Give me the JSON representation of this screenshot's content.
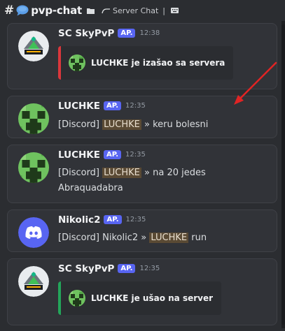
{
  "header": {
    "channel_name": "pvp-chat",
    "topic": "Server Chat",
    "separator": "|"
  },
  "messages": [
    {
      "author": "SC SkyPvP",
      "badge": "AP.",
      "time": "12:38",
      "embed_text": "LUCHKE je izašao sa servera",
      "embed_color": "#da373c"
    },
    {
      "author": "LUCHKE",
      "badge": "AP.",
      "time": "12:35",
      "prefix": "[Discord]",
      "mention": "LUCHKE",
      "arrow": "»",
      "text": "keru bolesni"
    },
    {
      "author": "LUCHKE",
      "badge": "AP.",
      "time": "12:35",
      "prefix": "[Discord]",
      "mention": "LUCHKE",
      "arrow": "»",
      "text": "na 20 jedes",
      "text2": "Abraquadabra"
    },
    {
      "author": "Nikolic2",
      "badge": "AP.",
      "time": "12:35",
      "prefix": "[Discord] Nikolic2",
      "arrow": "»",
      "mention": "LUCHKE",
      "text": "run"
    },
    {
      "author": "SC SkyPvP",
      "badge": "AP.",
      "time": "12:35",
      "embed_text": "LUCHKE je ušao na server",
      "embed_color": "#23a55a"
    }
  ],
  "colors": {
    "background": "#2b2d31",
    "card": "#313338",
    "badge": "#5865f2",
    "mention_highlight": "#5a4a34",
    "leave_bar": "#da373c",
    "join_bar": "#23a55a",
    "annotation_arrow": "#e02424"
  },
  "icons": [
    "hashtag-icon",
    "speech-bubble-icon",
    "folder-icon",
    "thread-icon",
    "keyboard-icon",
    "creeper-head-icon",
    "discord-logo-icon",
    "skywars-logo-icon",
    "red-arrow-annotation"
  ]
}
